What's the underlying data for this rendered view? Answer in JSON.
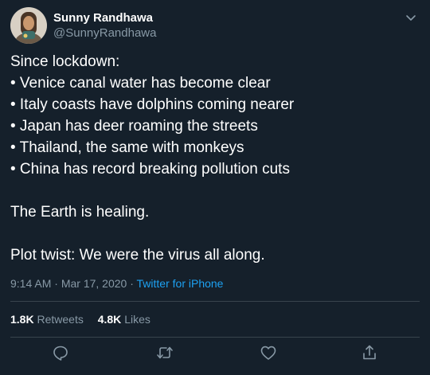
{
  "author": {
    "display_name": "Sunny Randhawa",
    "handle": "@SunnyRandhawa"
  },
  "tweet": {
    "lines": [
      "Since lockdown:",
      "• Venice canal water has become clear",
      "• Italy coasts have dolphins coming nearer",
      "• Japan has deer roaming the streets",
      "• Thailand, the same with monkeys",
      "• China has record breaking pollution cuts",
      "",
      "The Earth is healing.",
      "",
      "Plot twist: We were the virus all along."
    ],
    "time": "9:14 AM",
    "separator": "·",
    "date": "Mar 17, 2020",
    "source": "Twitter for iPhone"
  },
  "stats": {
    "retweets_count": "1.8K",
    "retweets_label": "Retweets",
    "likes_count": "4.8K",
    "likes_label": "Likes"
  },
  "icons": {
    "caret": "chevron-down-icon",
    "reply": "reply-icon",
    "retweet": "retweet-icon",
    "like": "heart-icon",
    "share": "share-icon"
  },
  "colors": {
    "background": "#15202b",
    "secondary_text": "#8899a6",
    "link": "#1da1f2",
    "divider": "#38444d"
  }
}
